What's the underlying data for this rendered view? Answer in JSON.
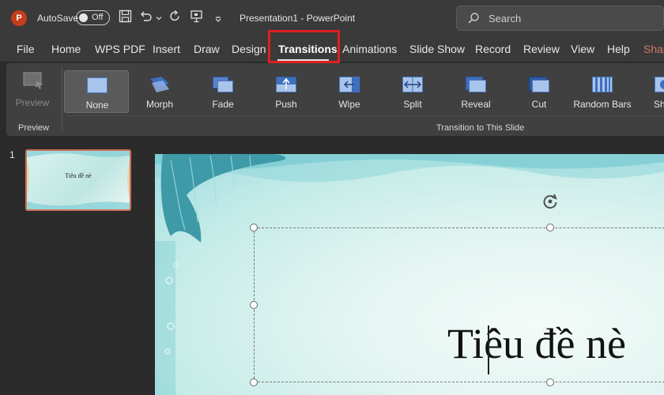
{
  "titlebar": {
    "app_logo": "P",
    "autosave_label": "AutoSave",
    "autosave_state": "Off",
    "doc_title": "Presentation1  -  PowerPoint",
    "search_placeholder": "Search"
  },
  "tabs": [
    {
      "label": "File"
    },
    {
      "label": "Home"
    },
    {
      "label": "WPS PDF"
    },
    {
      "label": "Insert"
    },
    {
      "label": "Draw"
    },
    {
      "label": "Design"
    },
    {
      "label": "Transitions",
      "active": true
    },
    {
      "label": "Animations"
    },
    {
      "label": "Slide Show"
    },
    {
      "label": "Record"
    },
    {
      "label": "Review"
    },
    {
      "label": "View"
    },
    {
      "label": "Help"
    },
    {
      "label": "Shap"
    }
  ],
  "ribbon": {
    "preview_label": "Preview",
    "preview_group": "Preview",
    "transition_group": "Transition to This Slide",
    "transitions": [
      {
        "label": "None",
        "selected": true
      },
      {
        "label": "Morph"
      },
      {
        "label": "Fade"
      },
      {
        "label": "Push"
      },
      {
        "label": "Wipe"
      },
      {
        "label": "Split"
      },
      {
        "label": "Reveal"
      },
      {
        "label": "Cut"
      },
      {
        "label": "Random Bars"
      },
      {
        "label": "Sh"
      }
    ]
  },
  "pane": {
    "slide_number": "1",
    "thumb_title": "Tiêu đề nè"
  },
  "slide": {
    "title": "Tiêu đề nè"
  },
  "colors": {
    "accent": "#c43e1c",
    "highlight": "#e02020",
    "thumb_border": "#d07058"
  }
}
